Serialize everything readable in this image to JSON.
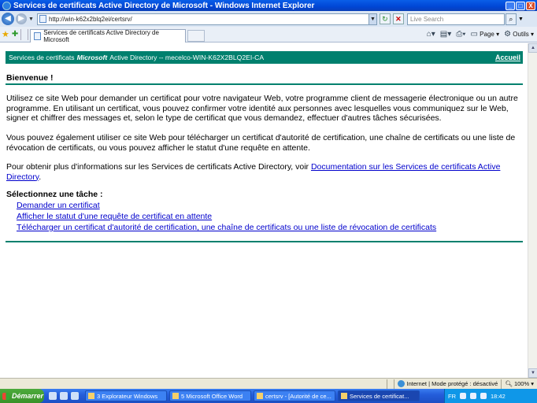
{
  "window": {
    "title": "Services de certificats Active Directory de Microsoft - Windows Internet Explorer",
    "buttons": {
      "minimize": "_",
      "maximize": "□",
      "close": "X"
    }
  },
  "addressbar": {
    "url": "http://win-k62x2blq2ei/certsrv/",
    "search_placeholder": "Live Search"
  },
  "tabs": [
    {
      "label": "Services de certificats Active Directory de Microsoft"
    }
  ],
  "command_bar": {
    "page_label": "Page",
    "tools_label": "Outils"
  },
  "page": {
    "header": {
      "prefix": "Services de certificats",
      "brand": "Microsoft",
      "suffix": "Active Directory  --  mecelco-WIN-K62X2BLQ2EI-CA",
      "home_link": "Accueil"
    },
    "welcome": "Bienvenue !",
    "paragraph1": "Utilisez ce site Web pour demander un certificat pour votre navigateur Web, votre programme client de messagerie électronique ou un autre programme. En utilisant un certificat, vous pouvez confirmer votre identité aux personnes avec lesquelles vous communiquez sur le Web, signer et chiffrer des messages et, selon le type de certificat que vous demandez, effectuer d'autres tâches sécurisées.",
    "paragraph2": "Vous pouvez également utiliser ce site Web pour télécharger un certificat d'autorité de certification, une chaîne de certificats ou une liste de révocation de certificats, ou vous pouvez afficher le statut d'une requête en attente.",
    "paragraph3_prefix": "Pour obtenir plus d'informations sur les Services de certificats Active Directory, voir ",
    "paragraph3_link": "Documentation sur les Services de certificats Active Directory",
    "paragraph3_suffix": ".",
    "tasks_title": "Sélectionnez une tâche :",
    "tasks": [
      "Demander un certificat",
      "Afficher le statut d'une requête de certificat en attente",
      "Télécharger un certificat d'autorité de certification, une chaîne de certificats ou une liste de révocation de certificats"
    ]
  },
  "statusbar": {
    "zone": "Internet | Mode protégé : désactivé",
    "zoom": "100%"
  },
  "taskbar": {
    "start_label": "Démarrer",
    "buttons": [
      {
        "label": "3 Explorateur Windows",
        "active": false
      },
      {
        "label": "5 Microsoft Office Word",
        "active": false
      },
      {
        "label": "certsrv - [Autorité de ce...",
        "active": false
      },
      {
        "label": "Services de certificat...",
        "active": true
      }
    ],
    "language": "FR",
    "clock": "18:42"
  }
}
